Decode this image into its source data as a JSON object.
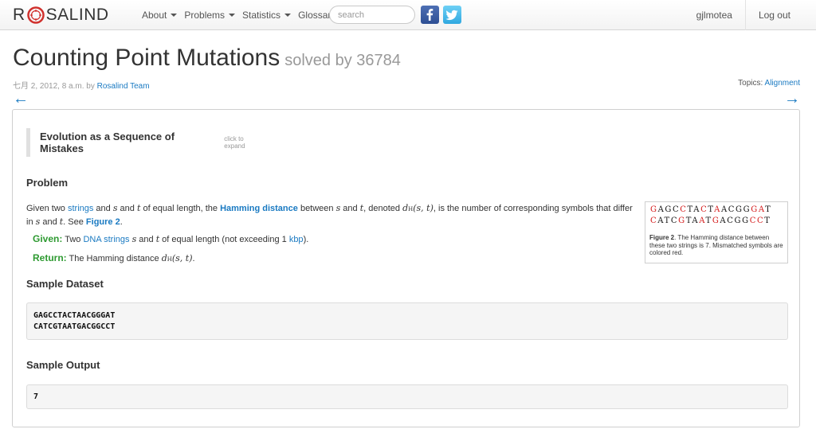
{
  "navbar": {
    "brand_left": "R",
    "brand_right": "SALIND",
    "menu": [
      {
        "label": "About",
        "has_caret": true
      },
      {
        "label": "Problems",
        "has_caret": true
      },
      {
        "label": "Statistics",
        "has_caret": true
      },
      {
        "label": "Glossary",
        "has_caret": false
      }
    ],
    "search_placeholder": "search",
    "username": "gjlmotea",
    "logout": "Log out"
  },
  "title": "Counting Point Mutations",
  "solved_by": "solved by 36784",
  "meta": {
    "date": "七月 2, 2012, 8 a.m. by ",
    "author": "Rosalind Team"
  },
  "topics": {
    "label": "Topics",
    "value": "Alignment"
  },
  "nav_arrows": {
    "prev": "←",
    "next": "→"
  },
  "story": {
    "title": "Evolution as a Sequence of Mistakes",
    "hint": "click to expand"
  },
  "problem": {
    "heading": "Problem",
    "p1_a": "Given two ",
    "p1_link_strings": "strings",
    "p1_b": " and ",
    "p1_c": " of equal length, the ",
    "p1_link_hamming": "Hamming distance",
    "p1_d": " between ",
    "p1_e": " and ",
    "p1_f": ", denoted ",
    "p1_g": ", is the number of corresponding symbols that differ in ",
    "p1_h": " and ",
    "p1_i": ". See ",
    "p1_link_fig": "Figure 2",
    "p1_j": ".",
    "var_s": "s",
    "var_t": "t",
    "math_d": "d",
    "math_sub": "H",
    "math_args": "(s, t)",
    "given_label": "Given:",
    "given_a": " Two ",
    "given_link_dna": "DNA strings",
    "given_b": " and ",
    "given_c": " of equal length (not exceeding 1 ",
    "given_link_kbp": "kbp",
    "given_d": ").",
    "return_label": "Return:",
    "return_a": " The Hamming distance ",
    "return_b": "."
  },
  "figure": {
    "row1": [
      {
        "c": "G",
        "diff": true
      },
      {
        "c": "A",
        "diff": false
      },
      {
        "c": "G",
        "diff": false
      },
      {
        "c": "C",
        "diff": false
      },
      {
        "c": "C",
        "diff": true
      },
      {
        "c": "T",
        "diff": false
      },
      {
        "c": "A",
        "diff": false
      },
      {
        "c": "C",
        "diff": true
      },
      {
        "c": "T",
        "diff": false
      },
      {
        "c": "A",
        "diff": true
      },
      {
        "c": "A",
        "diff": false
      },
      {
        "c": "C",
        "diff": false
      },
      {
        "c": "G",
        "diff": false
      },
      {
        "c": "G",
        "diff": false
      },
      {
        "c": "G",
        "diff": true
      },
      {
        "c": "A",
        "diff": true
      },
      {
        "c": "T",
        "diff": false
      }
    ],
    "row2": [
      {
        "c": "C",
        "diff": true
      },
      {
        "c": "A",
        "diff": false
      },
      {
        "c": "T",
        "diff": false
      },
      {
        "c": "C",
        "diff": false
      },
      {
        "c": "G",
        "diff": true
      },
      {
        "c": "T",
        "diff": false
      },
      {
        "c": "A",
        "diff": false
      },
      {
        "c": "A",
        "diff": true
      },
      {
        "c": "T",
        "diff": false
      },
      {
        "c": "G",
        "diff": true
      },
      {
        "c": "A",
        "diff": false
      },
      {
        "c": "C",
        "diff": false
      },
      {
        "c": "G",
        "diff": false
      },
      {
        "c": "G",
        "diff": false
      },
      {
        "c": "C",
        "diff": true
      },
      {
        "c": "C",
        "diff": true
      },
      {
        "c": "T",
        "diff": false
      }
    ],
    "caption_label": "Figure 2",
    "caption_text": ". The Hamming distance between these two strings is 7. Mismatched symbols are colored red."
  },
  "sample_dataset": {
    "heading": "Sample Dataset",
    "line1": "GAGCCTACTAACGGGAT",
    "line2": "CATCGTAATGACGGCCT"
  },
  "sample_output": {
    "heading": "Sample Output",
    "value": "7"
  },
  "colors": {
    "link": "#1a7ac2",
    "given_green": "#2e9a31",
    "mismatch_red": "#d41919",
    "logo_red": "#d0312d"
  }
}
